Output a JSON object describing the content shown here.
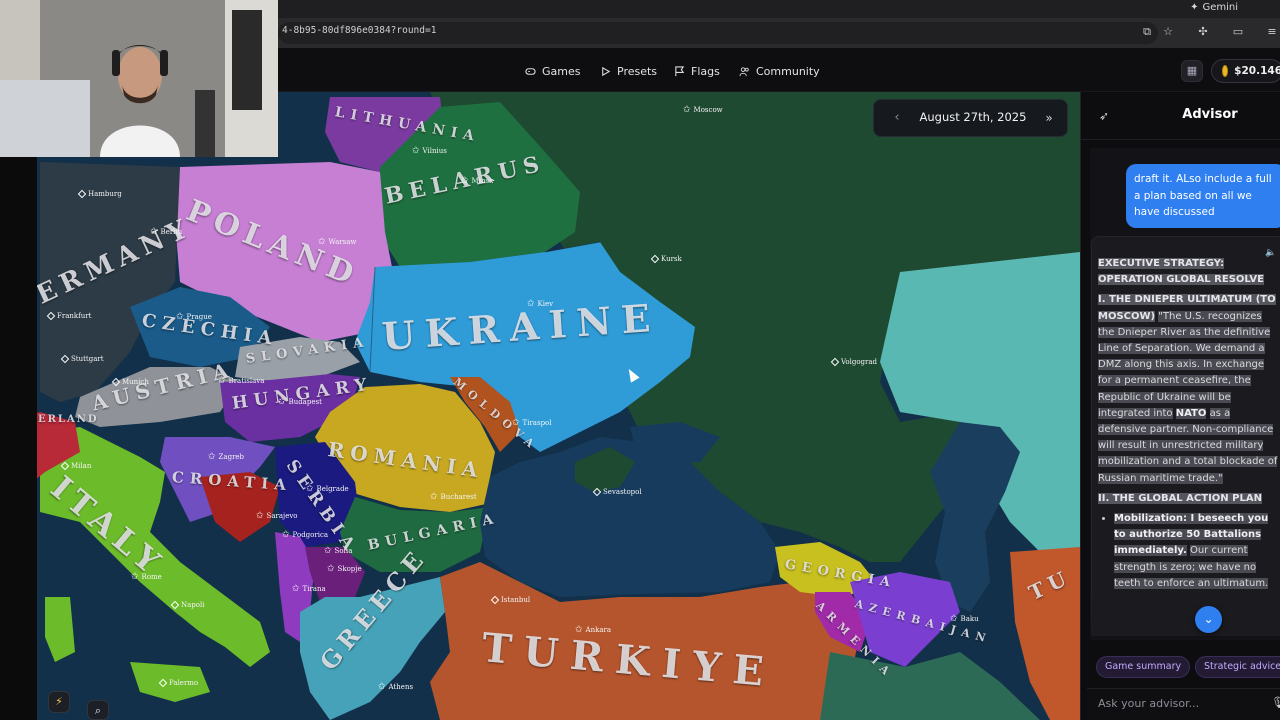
{
  "browser": {
    "url": "4-8b95-80df896e0384?round=1",
    "profile_label": "Gemini",
    "icons": [
      "cast-icon",
      "star-icon",
      "extensions-icon",
      "split-icon",
      "menu-icon"
    ]
  },
  "nav": {
    "items": [
      {
        "label": "Games",
        "icon": "gamepad-icon"
      },
      {
        "label": "Presets",
        "icon": "play-icon"
      },
      {
        "label": "Flags",
        "icon": "flag-icon"
      },
      {
        "label": "Community",
        "icon": "people-icon"
      }
    ],
    "balance": "$20.146"
  },
  "date_bar": {
    "date": "August 27th, 2025",
    "prev": "‹",
    "fast_forward": "»"
  },
  "map": {
    "countries": [
      "LITHUANIA",
      "BELARUS",
      "POLAND",
      "GERMANY",
      "CZECHIA",
      "SLOVAKIA",
      "AUSTRIA",
      "HUNGARY",
      "UKRAINE",
      "MOLDOVA",
      "ROMANIA",
      "CROATIA",
      "SERBIA",
      "BULGARIA",
      "ITALY",
      "GREECE",
      "TURKIYE",
      "GEORGIA",
      "ARMENIA",
      "AZERBAIJAN",
      "TU",
      "ITALY"
    ],
    "country_labels_visible": {
      "lithuania": "LITHUANIA",
      "belarus": "BELARUS",
      "poland": "POLAND",
      "germany": "ERMANY",
      "czechia": "CZECHIA",
      "slovakia": "SLOVAKIA",
      "austria": "AUSTRIA",
      "hungary": "HUNGARY",
      "ukraine": "UKRAINE",
      "moldova": "MOLDOVA",
      "romania": "ROMANIA",
      "croatia": "CROATIA",
      "serbia": "SERBIA",
      "bulgaria": "BULGARIA",
      "italy": "ITALY",
      "greece": "GREECE",
      "turkiye": "TURKIYE",
      "georgia": "GEORGIA",
      "armenia": "ARMENIA",
      "azerbaijan": "AZERBAIJAN",
      "tu_partial": "TU",
      "ireland_partial": "ERLAND"
    },
    "cities": {
      "moscow": "Moscow",
      "vilnius": "Vilnius",
      "minsk": "Minsk",
      "warsaw": "Warsaw",
      "berlin": "Berlin",
      "hamburg": "Hamburg",
      "kursk": "Kursk",
      "kiev": "Kiev",
      "prague": "Prague",
      "frankfurt": "Frankfurt",
      "stuttgart": "Stuttgart",
      "munich": "Munich",
      "bratislava": "Bratislava",
      "budapest": "Budapest",
      "volgograd": "Volgograd",
      "tiraspol": "Tiraspol",
      "sevastopol": "Sevastopol",
      "zagreb": "Zagreb",
      "belgrade": "Belgrade",
      "bucharest": "Bucharest",
      "sarajevo": "Sarajevo",
      "podgorica": "Podgorica",
      "skopje": "Skopje",
      "tirana": "Tirana",
      "sofia": "Sofia",
      "milan": "Milan",
      "rome": "Rome",
      "napoli": "Napoli",
      "palermo": "Palermo",
      "istanbul": "Istanbul",
      "ankara": "Ankara",
      "athens": "Athens",
      "baku": "Baku"
    },
    "colors": {
      "russia": "#1e4a33",
      "ukraine": "#2e9bd6",
      "poland": "#c476d0",
      "belarus": "#1f6e3f",
      "romania": "#c9a91f",
      "turkiye": "#b4542c",
      "italy": "#6fb82a",
      "sea": "#173b5c",
      "kazakh": "#5bbfb9"
    }
  },
  "advisor": {
    "title": "Advisor",
    "user_message": "draft it. ALso include a full action plan based on all we have discussed",
    "user_message_visible": "draft it.  ALso include a full a plan based on all we have discussed",
    "heading1": "EXECUTIVE STRATEGY: OPERATION GLOBAL RESOLVE",
    "section1_title": "I. THE DNIEPER ULTIMATUM (TO MOSCOW)",
    "section1_body_a": "\"The U.S. recognizes the Dnieper River as the definitive Line of Separation. We demand a DMZ along this axis. In exchange for a permanent ceasefire, the Republic of Ukraine will be integrated into",
    "section1_bold": "NATO",
    "section1_body_b": "as a defensive partner. Non-compliance will result in unrestricted military mobilization and a total blockade of Russian maritime trade.\"",
    "section2_title": "II. THE GLOBAL ACTION PLAN",
    "bullet1_bold": "Mobilization: I beseech you to authorize 50 Battalions immediately.",
    "bullet1_rest": "Our current strength is zero; we have no teeth to enforce an ultimatum.",
    "chips": [
      "Game summary",
      "Strategic advice"
    ],
    "input_placeholder": "Ask your advisor..."
  }
}
